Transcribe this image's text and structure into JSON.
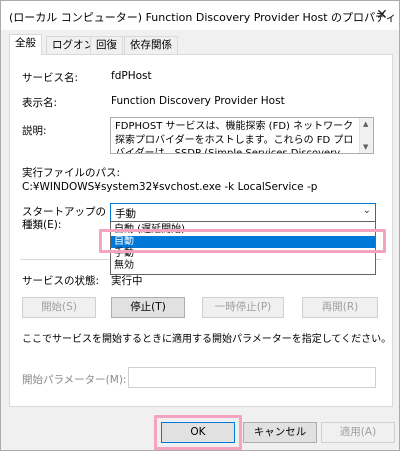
{
  "window": {
    "title": "(ローカル コンピューター) Function Discovery Provider Host のプロパティ",
    "close_glyph": "✕"
  },
  "tabs": [
    {
      "label": "全般",
      "active": true
    },
    {
      "label": "ログオン",
      "active": false
    },
    {
      "label": "回復",
      "active": false
    },
    {
      "label": "依存関係",
      "active": false
    }
  ],
  "general": {
    "service_name_label": "サービス名:",
    "service_name": "fdPHost",
    "display_name_label": "表示名:",
    "display_name": "Function Discovery Provider Host",
    "description_label": "説明:",
    "description": "FDPHOST サービスは、機能探索 (FD) ネットワーク探索プロバイダーをホストします。これらの FD プロバイダーは、SSDP (Simple Services Discovery Protocol) および WS-D (Web",
    "exe_path_label": "実行ファイルのパス:",
    "exe_path": "C:¥WINDOWS¥system32¥svchost.exe -k LocalService -p",
    "startup_type_label_line1": "スタートアップの",
    "startup_type_label_line2": "種類(E):",
    "startup_type_value": "手動",
    "startup_options": [
      {
        "label": "自動 (遅延開始)",
        "selected": false
      },
      {
        "label": "自動",
        "selected": true
      },
      {
        "label": "手動",
        "selected": false
      },
      {
        "label": "無効",
        "selected": false
      }
    ],
    "service_status_label": "サービスの状態:",
    "service_status": "実行中",
    "start_button": "開始(S)",
    "stop_button": "停止(T)",
    "pause_button": "一時停止(P)",
    "resume_button": "再開(R)",
    "hint_text": "ここでサービスを開始するときに適用する開始パラメーターを指定してください。",
    "start_params_label": "開始パラメーター(M):",
    "start_params_value": ""
  },
  "footer": {
    "ok_button": "OK",
    "cancel_button": "キャンセル",
    "apply_button": "適用(A)"
  },
  "colors": {
    "accent": "#0078d7",
    "highlight_annotation": "#f5a3c3"
  },
  "icons": {
    "dropdown_arrow": "chevron-down-icon",
    "close": "close-icon"
  }
}
